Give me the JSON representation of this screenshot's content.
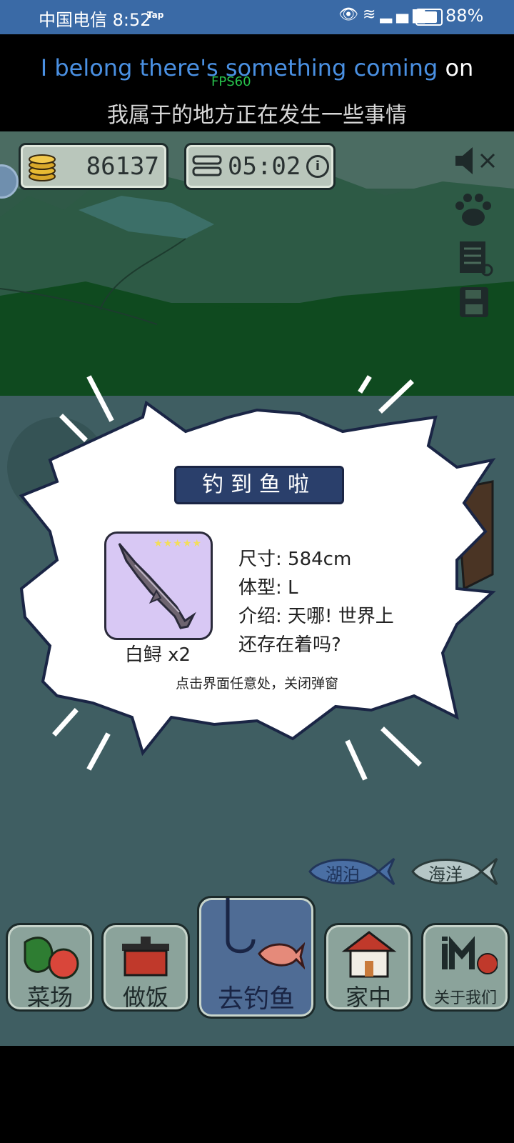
{
  "status_bar": {
    "carrier_time": "中国电信 8:52",
    "tap_badge": "Tap",
    "battery_pct": "88%"
  },
  "lyrics": {
    "line1_highlighted": "I belong there's something coming",
    "line1_rest": " on",
    "fps": "FPS60",
    "line2": "我属于的地方正在发生一些事情"
  },
  "hud": {
    "coins": "86137",
    "timer": "05:02",
    "info_icon": "i"
  },
  "popup": {
    "title": "钓到鱼啦",
    "fish_name": "白鲟 x2",
    "stars": "★★★★★",
    "rating_stars": 5,
    "size": "尺寸: 584cm",
    "body_type": "体型: L",
    "intro_line1": "介绍: 天哪! 世界上",
    "intro_line2": "还存在着吗?",
    "hint": "点击界面任意处，关闭弹窗"
  },
  "spots": {
    "lake": "湖泊",
    "sea": "海洋"
  },
  "nav": {
    "farm": "菜场",
    "cook": "做饭",
    "fish": "去钓鱼",
    "home": "家中",
    "about": "关于我们"
  },
  "colors": {
    "status_bar": "#3a6aa6",
    "lyric_highlight": "#4a90e2",
    "fps": "#27c24c",
    "popup_title_bg": "#2a3f6b",
    "fish_card_bg": "#d8c8f4",
    "nav_active": "#4f6c95"
  }
}
